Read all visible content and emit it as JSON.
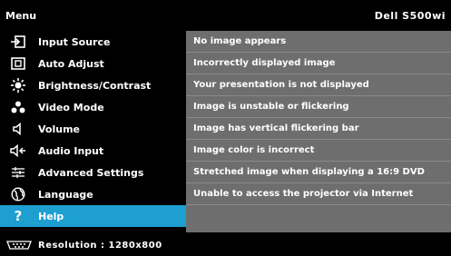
{
  "header": {
    "title": "Menu",
    "model": "Dell S500wi"
  },
  "menu": {
    "items": [
      {
        "label": "Input Source",
        "icon": "input-source-icon"
      },
      {
        "label": "Auto Adjust",
        "icon": "auto-adjust-icon"
      },
      {
        "label": "Brightness/Contrast",
        "icon": "brightness-icon"
      },
      {
        "label": "Video Mode",
        "icon": "video-mode-icon"
      },
      {
        "label": "Volume",
        "icon": "volume-icon"
      },
      {
        "label": "Audio Input",
        "icon": "audio-input-icon"
      },
      {
        "label": "Advanced Settings",
        "icon": "advanced-settings-icon"
      },
      {
        "label": "Language",
        "icon": "language-icon"
      },
      {
        "label": "Help",
        "icon": "help-icon"
      }
    ],
    "selected_index": 8
  },
  "help": {
    "items": [
      "No image appears",
      "Incorrectly displayed image",
      "Your presentation is not displayed",
      "Image is unstable or flickering",
      "Image has vertical flickering bar",
      "Image color is incorrect",
      "Stretched image when displaying a 16:9 DVD",
      "Unable to access the projector via Internet"
    ]
  },
  "footer": {
    "resolution": "Resolution : 1280x800",
    "icon": "connector-icon"
  },
  "colors": {
    "accent": "#1d9fd1",
    "panel": "#6e6e6e",
    "background": "#000000"
  }
}
